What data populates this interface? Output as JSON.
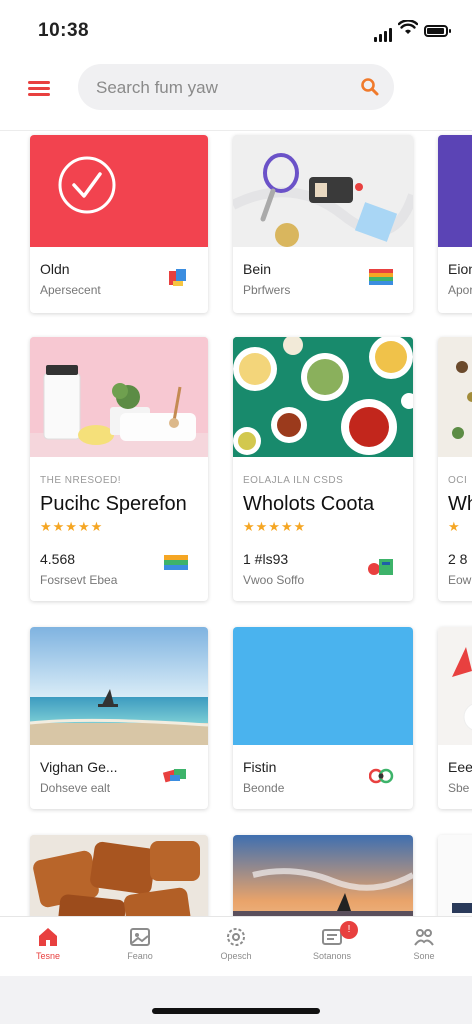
{
  "status_bar": {
    "time": "10:38"
  },
  "header": {
    "search_placeholder": "Search fum yaw"
  },
  "cards": [
    {
      "title": "Oldn",
      "sub": "Apersecent"
    },
    {
      "title": "Bein",
      "sub": "Pbrfwers"
    },
    {
      "title": "Eion",
      "sub": "Aporl"
    },
    {
      "kicker": "THE NRESOED!",
      "title": "Pucihc Sperefon",
      "rating": "★★★★★",
      "stat": "4.568",
      "stat_sub": "Fosrsevt Ebea"
    },
    {
      "kicker": "EOLAJLA ILN CSDS",
      "title": "Wholots Coota",
      "rating": "★★★★★",
      "stat": "1 #ls93",
      "stat_sub": "Vwoo Soffo"
    },
    {
      "kicker": "OCI",
      "title": "Wh",
      "rating": "★",
      "stat": "2 8",
      "stat_sub": "Eow"
    },
    {
      "title": "Vighan Ge...",
      "sub": "Dohseve ealt"
    },
    {
      "title": "Fistin",
      "sub": "Beonde"
    },
    {
      "title": "Eeer",
      "sub": "Sbe"
    }
  ],
  "tabs": [
    {
      "label": "Tesne",
      "icon": "home-icon",
      "active": true
    },
    {
      "label": "Feano",
      "icon": "gallery-icon",
      "active": false
    },
    {
      "label": "Opesch",
      "icon": "settings-icon",
      "active": false
    },
    {
      "label": "Sotanons",
      "icon": "notifications-icon",
      "active": false
    },
    {
      "label": "Sone",
      "icon": "profile-icon",
      "active": false
    }
  ],
  "notification_badge": "!",
  "colors": {
    "accent": "#e8403f",
    "star": "#f5a623",
    "sky_blue": "#4ab3ee",
    "coral": "#f2434f"
  }
}
